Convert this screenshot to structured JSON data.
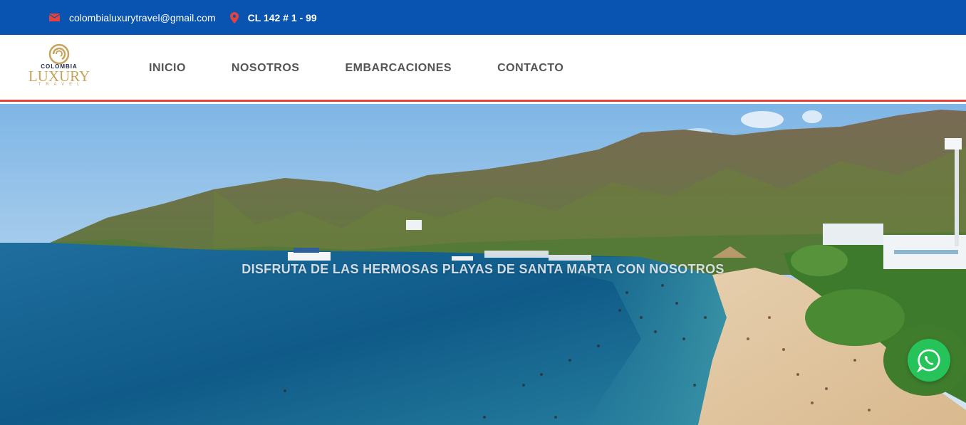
{
  "topbar": {
    "email": "colombialuxurytravel@gmail.com",
    "address": "CL 142 # 1 - 99",
    "email_icon": "envelope-icon",
    "address_icon": "map-pin-icon"
  },
  "logo": {
    "top_text": "COLOMBIA",
    "main_text": "LUXURY",
    "sub_text": "TRAVEL"
  },
  "nav": {
    "items": [
      {
        "label": "INICIO"
      },
      {
        "label": "NOSOTROS"
      },
      {
        "label": "EMBARCACIONES"
      },
      {
        "label": "CONTACTO"
      }
    ]
  },
  "hero": {
    "headline": "DISFRUTA DE LAS HERMOSAS PLAYAS DE SANTA MARTA CON NOSOTROS"
  },
  "whatsapp": {
    "icon": "whatsapp-icon"
  },
  "colors": {
    "topbar_bg": "#0a54b1",
    "accent_red": "#e7413c",
    "logo_gold": "#c7a45c",
    "whatsapp_green": "#25c35a"
  }
}
